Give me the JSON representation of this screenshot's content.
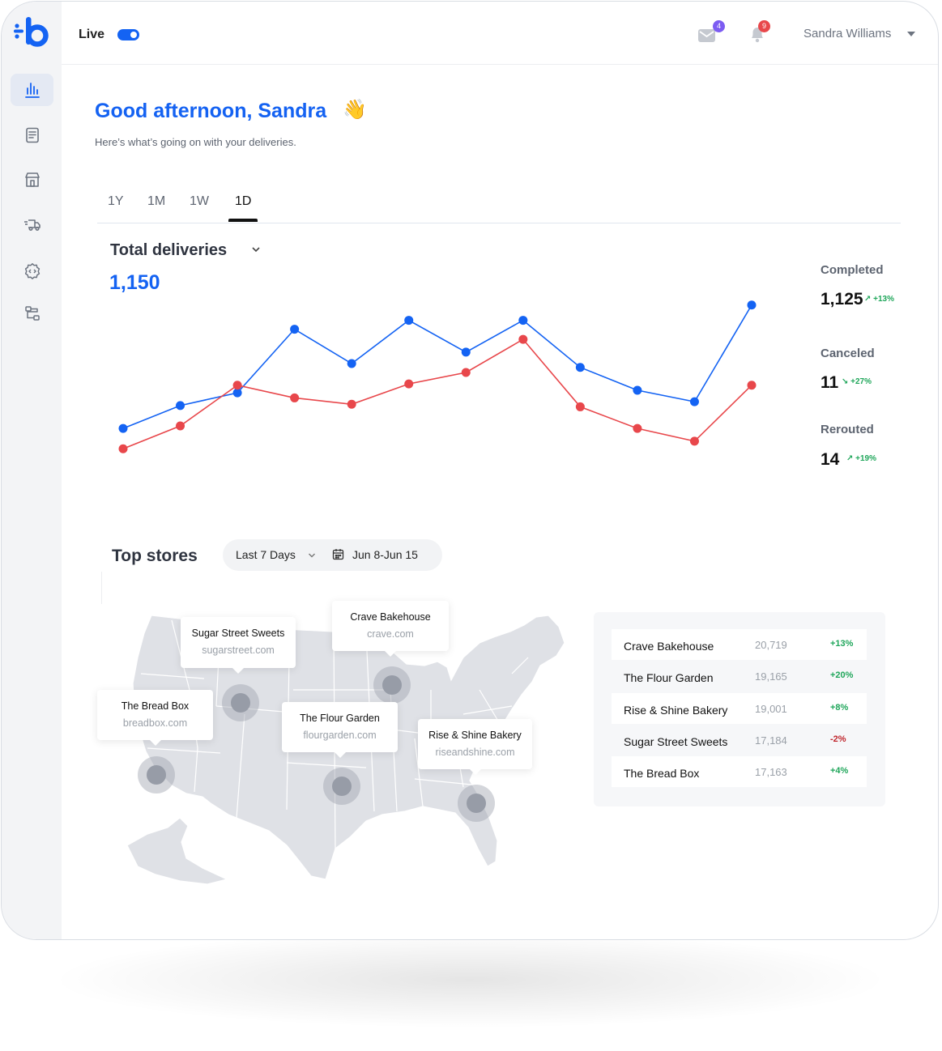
{
  "topbar": {
    "live_label": "Live",
    "mail_badge": "4",
    "bell_badge": "9",
    "user_name": "Sandra Williams"
  },
  "greeting": {
    "title": "Good afternoon, Sandra",
    "emoji": "👋",
    "subtitle": "Here’s what’s going on with your deliveries."
  },
  "tabs": [
    {
      "label": "1Y",
      "active": false
    },
    {
      "label": "1M",
      "active": false
    },
    {
      "label": "1W",
      "active": false
    },
    {
      "label": "1D",
      "active": true
    }
  ],
  "deliveries": {
    "title": "Total deliveries",
    "total": "1,150"
  },
  "chart_data": {
    "type": "line",
    "x": [
      1,
      2,
      3,
      4,
      5,
      6,
      7,
      8,
      9,
      10,
      11,
      12
    ],
    "series": [
      {
        "color": "#1463f3",
        "values": [
          40,
          58,
          68,
          118,
          91,
          125,
          100,
          125,
          88,
          70,
          61,
          137
        ]
      },
      {
        "color": "#e8474b",
        "values": [
          24,
          42,
          74,
          64,
          59,
          75,
          84,
          110,
          57,
          40,
          30,
          74
        ]
      }
    ],
    "ylim": [
      0,
      140
    ],
    "grid": false,
    "legend": "none"
  },
  "stats": [
    {
      "label": "Completed",
      "value": "1,125",
      "change": "↗ +13%"
    },
    {
      "label": "Canceled",
      "value": "11",
      "change": "↘ +27%"
    },
    {
      "label": "Rerouted",
      "value": "14",
      "change": "↗ +19%"
    }
  ],
  "top_stores": {
    "title": "Top stores",
    "range_label": "Last 7 Days",
    "dates": "Jun 8-Jun 15"
  },
  "map_tips": [
    {
      "name": "Sugar Street Sweets",
      "url": "sugarstreet.com"
    },
    {
      "name": "Crave Bakehouse",
      "url": "crave.com"
    },
    {
      "name": "The Bread Box",
      "url": "breadbox.com"
    },
    {
      "name": "The Flour Garden",
      "url": "flourgarden.com"
    },
    {
      "name": "Rise & Shine Bakery",
      "url": "riseandshine.com"
    }
  ],
  "stores_table": [
    {
      "name": "Crave Bakehouse",
      "value": "20,719",
      "change": "+13%",
      "color": "#1fa65a"
    },
    {
      "name": "The Flour Garden",
      "value": "19,165",
      "change": "+20%",
      "color": "#1fa65a"
    },
    {
      "name": "Rise & Shine Bakery",
      "value": "19,001",
      "change": "+8%",
      "color": "#1fa65a"
    },
    {
      "name": "Sugar Street Sweets",
      "value": "17,184",
      "change": "-2%",
      "color": "#c0262d"
    },
    {
      "name": "The Bread Box",
      "value": "17,163",
      "change": "+4%",
      "color": "#1fa65a"
    }
  ]
}
